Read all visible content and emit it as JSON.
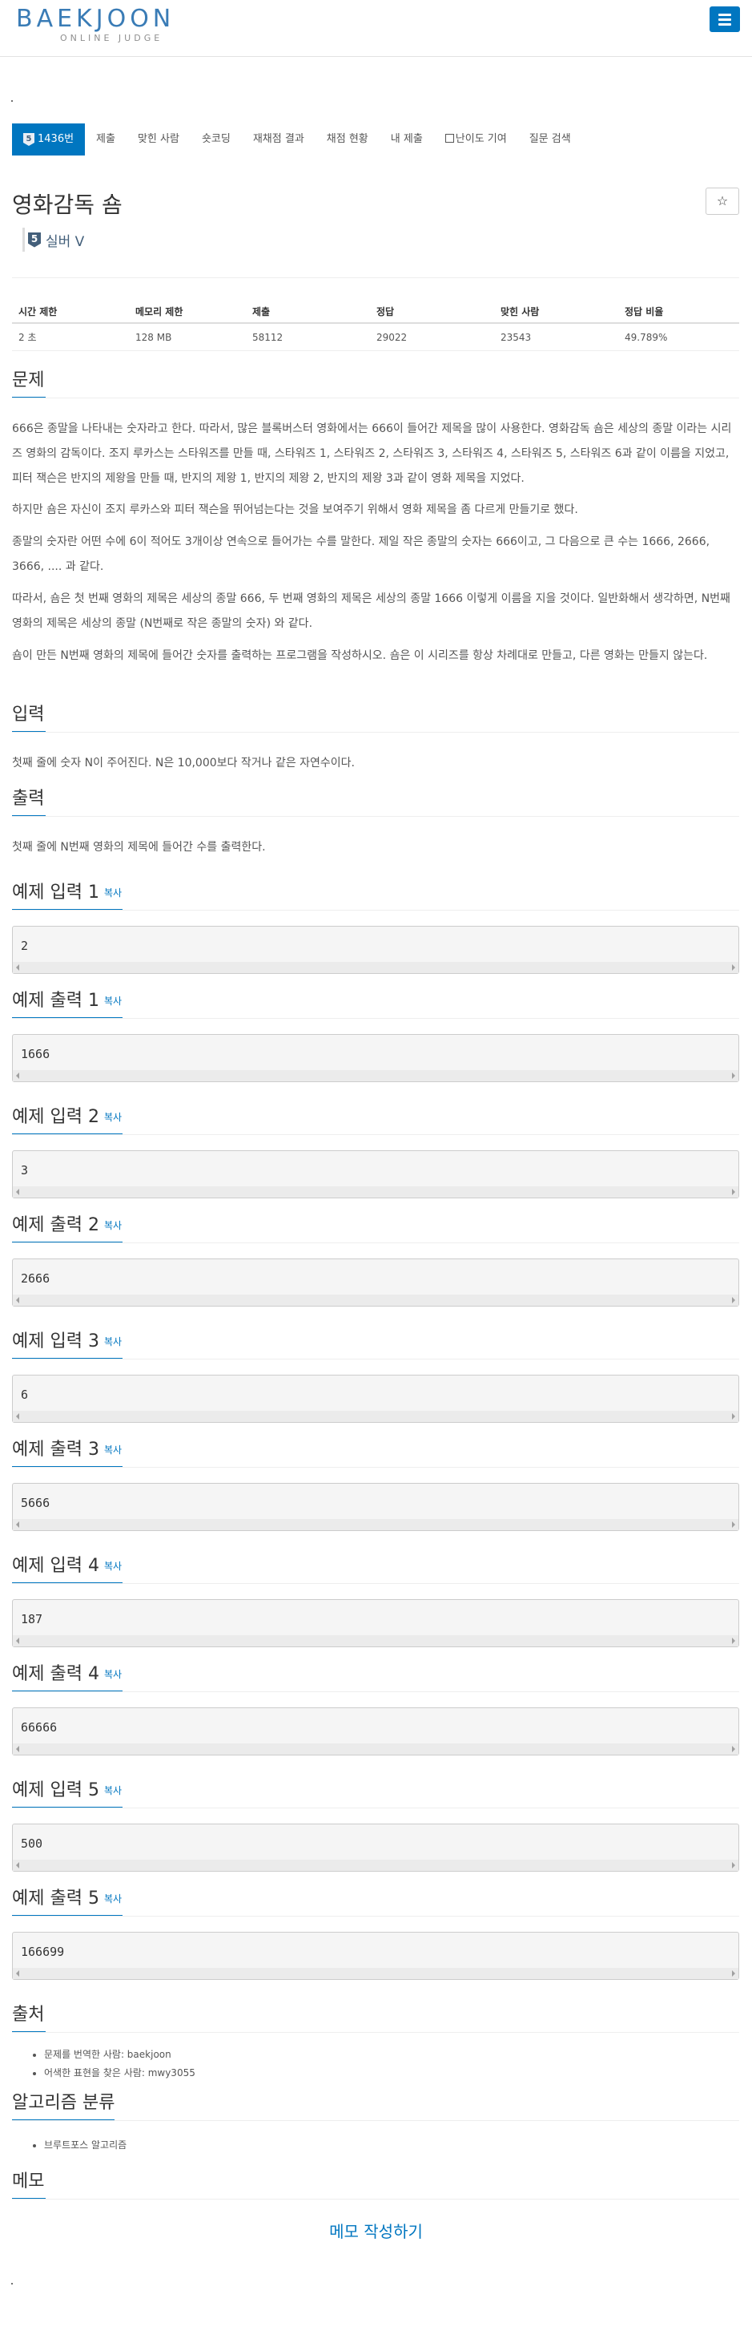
{
  "header": {
    "logo_text": "BAEKJOON",
    "logo_sub": "ONLINE JUDGE",
    "menu_icon": "hamburger-icon"
  },
  "tabs": [
    {
      "label": "1436번",
      "active": true,
      "icon": "silver5-tier-icon"
    },
    {
      "label": "제출"
    },
    {
      "label": "맞힌 사람"
    },
    {
      "label": "숏코딩"
    },
    {
      "label": "재채점 결과"
    },
    {
      "label": "채점 현황"
    },
    {
      "label": "내 제출"
    },
    {
      "label": "난이도 기여",
      "icon": "external-link-icon"
    },
    {
      "label": "질문 검색"
    }
  ],
  "problem": {
    "title": "영화감독 숌",
    "star": "☆",
    "tier_badge": "5",
    "tier_label": "실버 V"
  },
  "info": {
    "headers": [
      "시간 제한",
      "메모리 제한",
      "제출",
      "정답",
      "맞힌 사람",
      "정답 비율"
    ],
    "values": [
      "2 초",
      "128 MB",
      "58112",
      "29022",
      "23543",
      "49.789%"
    ]
  },
  "sections": {
    "problem_title": "문제",
    "problem_paras": [
      "666은 종말을 나타내는 숫자라고 한다. 따라서, 많은 블록버스터 영화에서는 666이 들어간 제목을 많이 사용한다. 영화감독 숌은 세상의 종말 이라는 시리즈 영화의 감독이다. 조지 루카스는 스타워즈를 만들 때, 스타워즈 1, 스타워즈 2, 스타워즈 3, 스타워즈 4, 스타워즈 5, 스타워즈 6과 같이 이름을 지었고, 피터 잭슨은 반지의 제왕을 만들 때, 반지의 제왕 1, 반지의 제왕 2, 반지의 제왕 3과 같이 영화 제목을 지었다.",
      "하지만 숌은 자신이 조지 루카스와 피터 잭슨을 뛰어넘는다는 것을 보여주기 위해서 영화 제목을 좀 다르게 만들기로 했다.",
      "종말의 숫자란 어떤 수에 6이 적어도 3개이상 연속으로 들어가는 수를 말한다. 제일 작은 종말의 숫자는 666이고, 그 다음으로 큰 수는 1666, 2666, 3666, .... 과 같다.",
      "따라서, 숌은 첫 번째 영화의 제목은 세상의 종말 666, 두 번째 영화의 제목은 세상의 종말 1666 이렇게 이름을 지을 것이다. 일반화해서 생각하면, N번째 영화의 제목은 세상의 종말 (N번째로 작은 종말의 숫자) 와 같다.",
      "숌이 만든 N번째 영화의 제목에 들어간 숫자를 출력하는 프로그램을 작성하시오. 숌은 이 시리즈를 항상 차례대로 만들고, 다른 영화는 만들지 않는다."
    ],
    "input_title": "입력",
    "input_text": "첫째 줄에 숫자 N이 주어진다. N은 10,000보다 작거나 같은 자연수이다.",
    "output_title": "출력",
    "output_text": "첫째 줄에 N번째 영화의 제목에 들어간 수를 출력한다.",
    "copy_label": "복사",
    "samples": [
      {
        "title": "예제 입력 1",
        "value": "2"
      },
      {
        "title": "예제 출력 1",
        "value": "1666"
      },
      {
        "title": "예제 입력 2",
        "value": "3"
      },
      {
        "title": "예제 출력 2",
        "value": "2666"
      },
      {
        "title": "예제 입력 3",
        "value": "6"
      },
      {
        "title": "예제 출력 3",
        "value": "5666"
      },
      {
        "title": "예제 입력 4",
        "value": "187"
      },
      {
        "title": "예제 출력 4",
        "value": "66666"
      },
      {
        "title": "예제 입력 5",
        "value": "500"
      },
      {
        "title": "예제 출력 5",
        "value": "166699"
      }
    ],
    "source_title": "출처",
    "source_items": [
      "문제를 번역한 사람: baekjoon",
      "어색한 표현을 찾은 사람: mwy3055"
    ],
    "algo_title": "알고리즘 분류",
    "algo_items": [
      "브루트포스 알고리즘"
    ],
    "memo_title": "메모",
    "memo_link": "메모 작성하기"
  }
}
